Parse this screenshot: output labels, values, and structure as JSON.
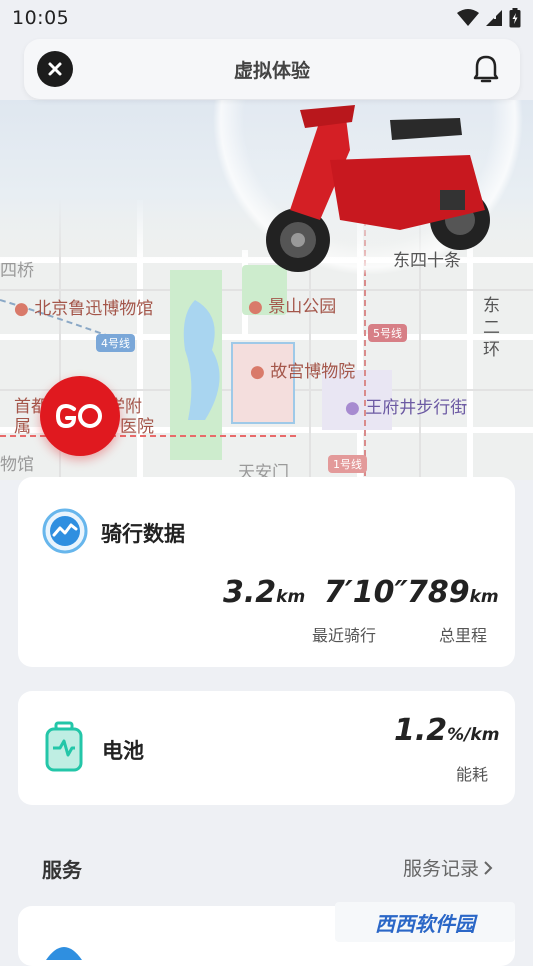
{
  "status_bar": {
    "time": "10:05"
  },
  "header": {
    "title": "虚拟体验"
  },
  "map": {
    "labels": {
      "dongsi": "东四十条",
      "lu_xun": "北京鲁迅博物馆",
      "jingshan": "景山公园",
      "dongerhuan": "东二环",
      "gugong": "故宫博物院",
      "wangfujing": "王府井步行街",
      "tiananmen": "天安门",
      "shoudu": "首都",
      "shu": "属",
      "xuefu": "学附",
      "yiyuan": "医院",
      "wuguan": "物馆",
      "qiao": "四桥"
    },
    "metro": {
      "line4": "4号线",
      "line5": "5号线",
      "line1": "1号线"
    }
  },
  "go_button": {
    "label": "GO"
  },
  "ride_card": {
    "title": "骑行数据",
    "recent_distance": {
      "value": "3.2",
      "unit": "km"
    },
    "recent_time": {
      "value": "7′10″"
    },
    "recent_label": "最近骑行",
    "total_distance": {
      "value": "789",
      "unit": "km"
    },
    "total_label": "总里程"
  },
  "battery_card": {
    "title": "电池",
    "consumption": {
      "value": "1.2",
      "unit": "%/km"
    },
    "consumption_label": "能耗"
  },
  "services": {
    "title": "服务",
    "record_link": "服务记录"
  },
  "colors": {
    "accent_red": "#e0191f",
    "ride_icon_blue": "#2f8fe0",
    "battery_green": "#23c6a8"
  },
  "watermark": {
    "text": "西西软件园"
  }
}
